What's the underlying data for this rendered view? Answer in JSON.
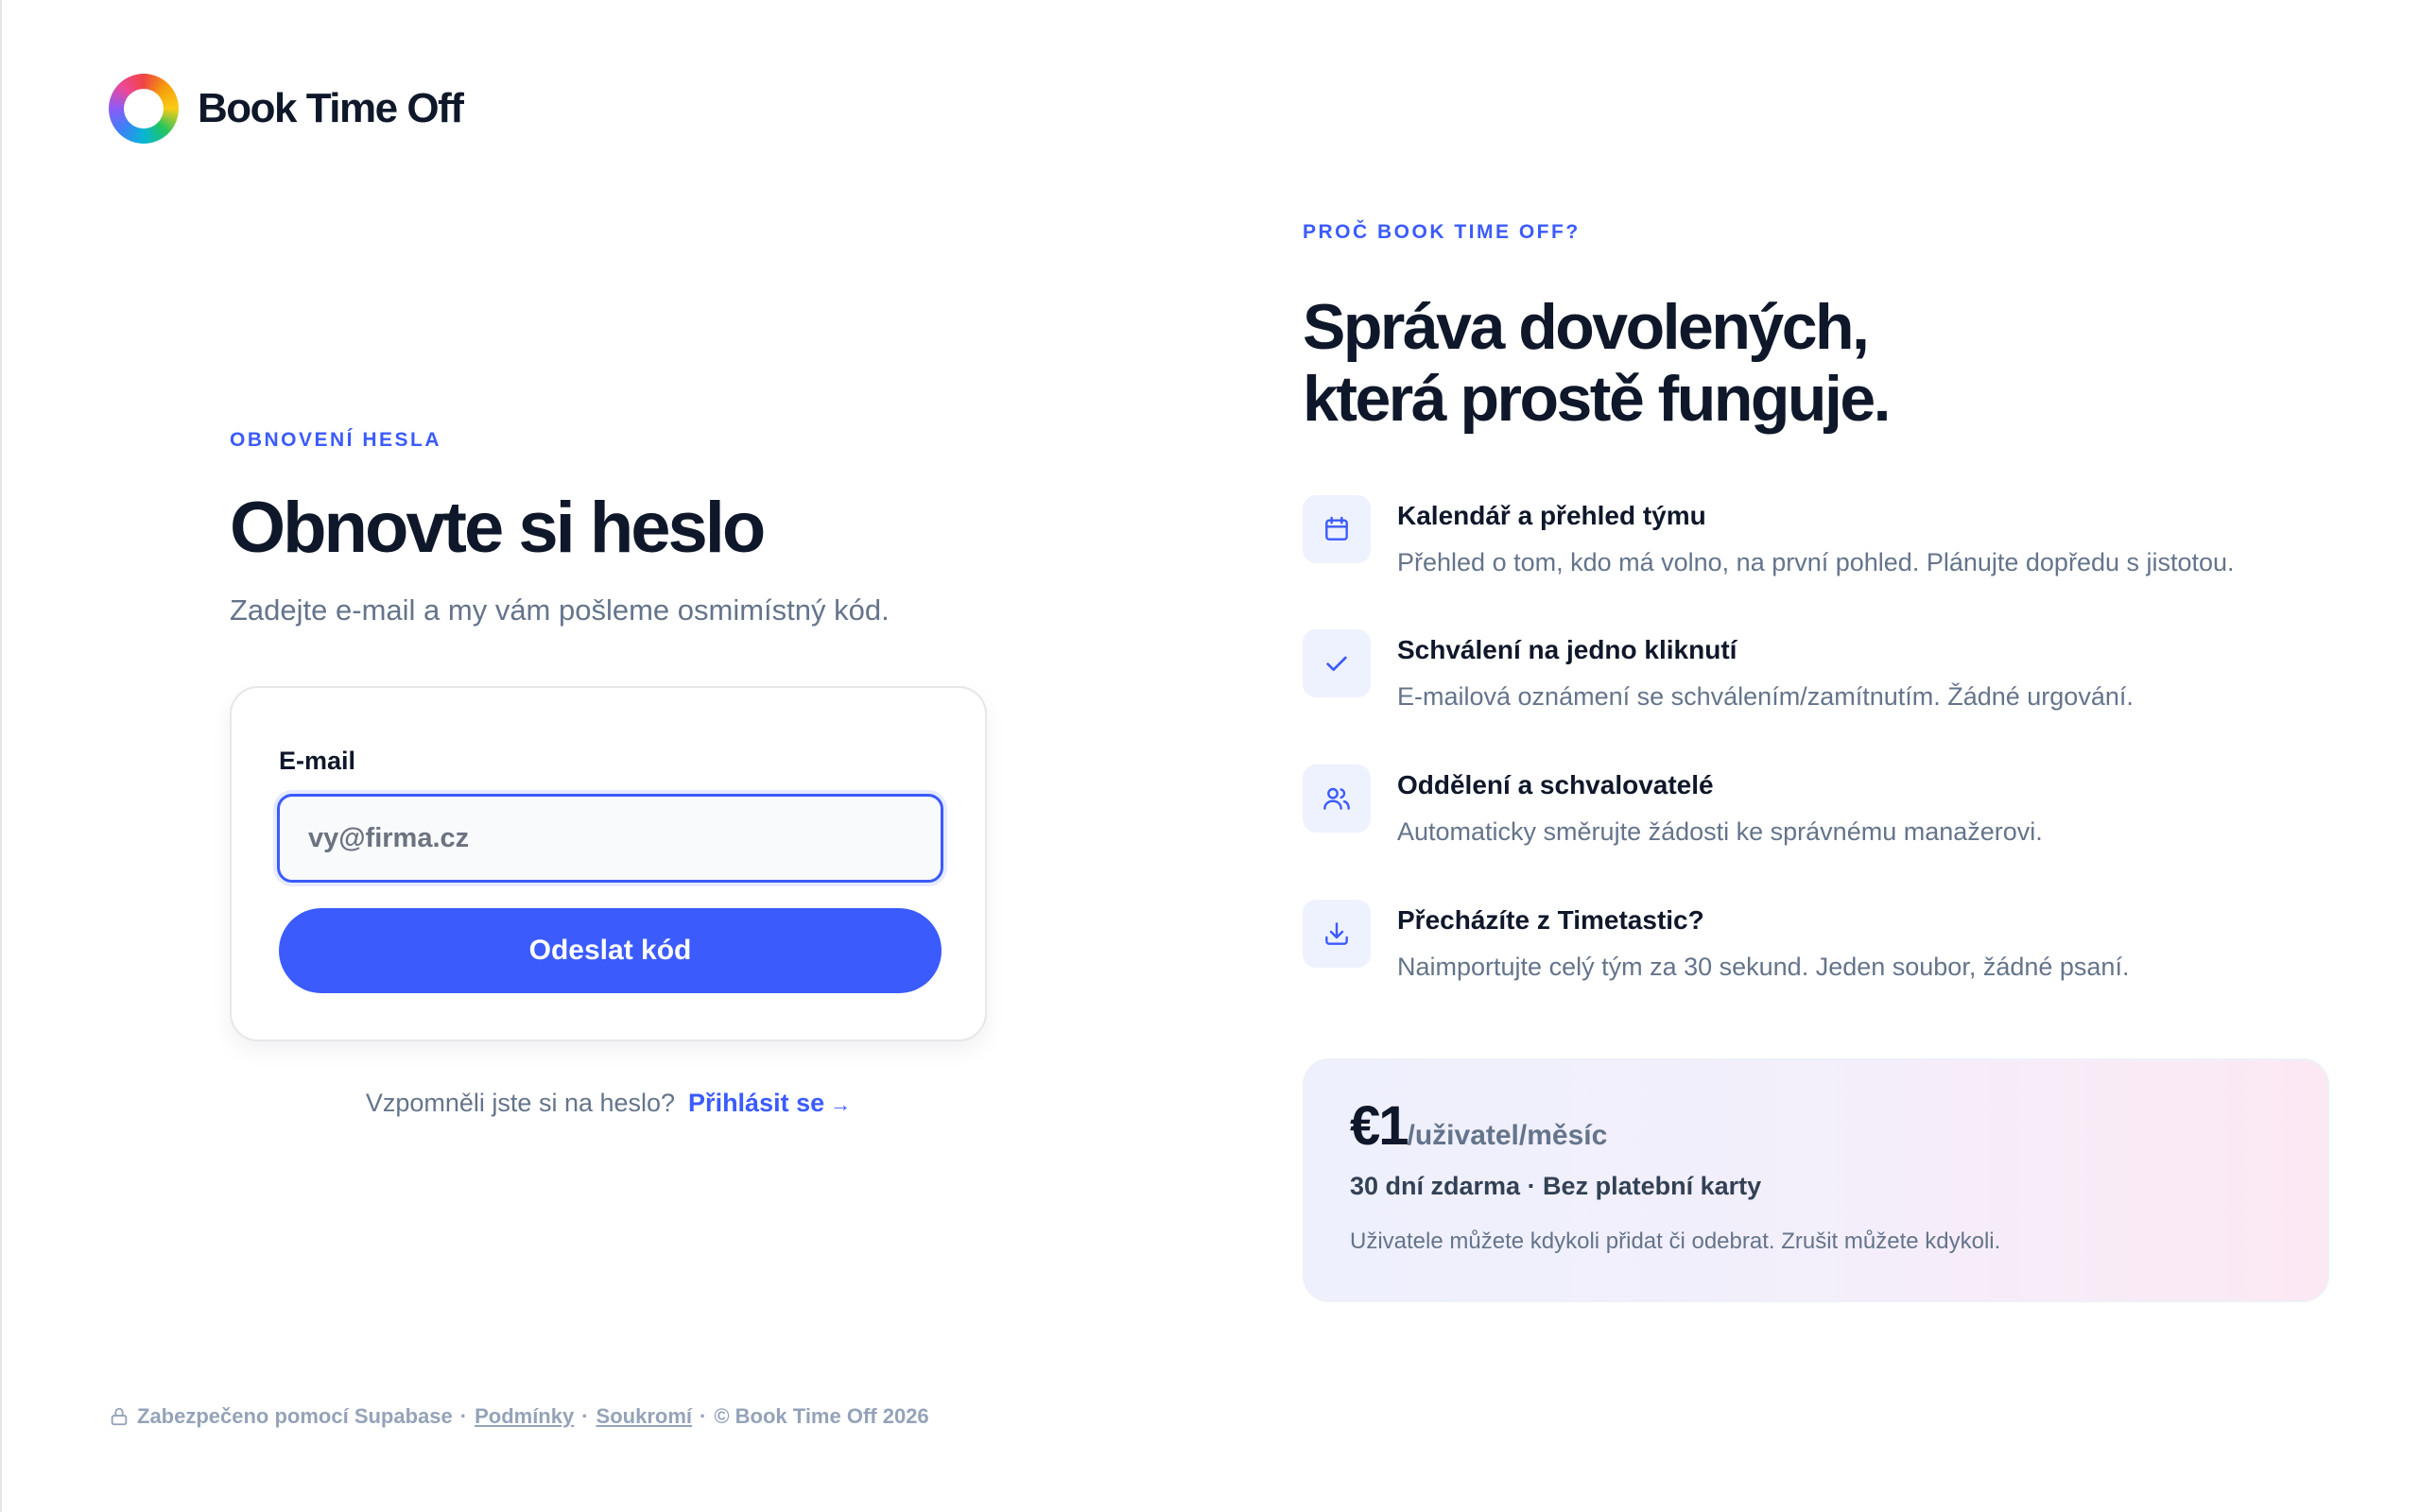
{
  "brand": {
    "name": "Book Time Off"
  },
  "reset": {
    "eyebrow": "OBNOVENÍ HESLA",
    "title": "Obnovte si heslo",
    "subtitle": "Zadejte e-mail a my vám pošleme osmimístný kód.",
    "email_label": "E-mail",
    "email_placeholder": "vy@firma.cz",
    "email_value": "",
    "submit_label": "Odeslat kód",
    "remember_text": "Vzpomněli jste si na heslo?",
    "login_link": "Přihlásit se",
    "login_arrow": "→"
  },
  "footer": {
    "secured": "Zabezpečeno pomocí Supabase",
    "sep": "·",
    "terms": "Podmínky",
    "privacy": "Soukromí",
    "copyright": "© Book Time Off 2026"
  },
  "why": {
    "eyebrow": "PROČ BOOK TIME OFF?",
    "headline_line1": "Správa dovolených,",
    "headline_line2": "která prostě funguje.",
    "features": [
      {
        "icon": "calendar-icon",
        "title": "Kalendář a přehled týmu",
        "desc": "Přehled o tom, kdo má volno, na první pohled. Plánujte dopředu s jistotou."
      },
      {
        "icon": "check-icon",
        "title": "Schválení na jedno kliknutí",
        "desc": "E-mailová oznámení se schválením/zamítnutím. Žádné urgování."
      },
      {
        "icon": "users-icon",
        "title": "Oddělení a schvalovatelé",
        "desc": "Automaticky směrujte žádosti ke správnému manažerovi."
      },
      {
        "icon": "download-icon",
        "title": "Přecházíte z Timetastic?",
        "desc": "Naimportujte celý tým za 30 sekund. Jeden soubor, žádné psaní."
      }
    ]
  },
  "pricing": {
    "amount": "€1",
    "unit": "/uživatel/měsíc",
    "trial": "30 dní zdarma · Bez platební karty",
    "note": "Uživatele můžete kdykoli přidat či odebrat. Zrušit můžete kdykoli."
  },
  "colors": {
    "accent": "#3b5bfd",
    "text": "#0f172a",
    "muted": "#64748b"
  }
}
